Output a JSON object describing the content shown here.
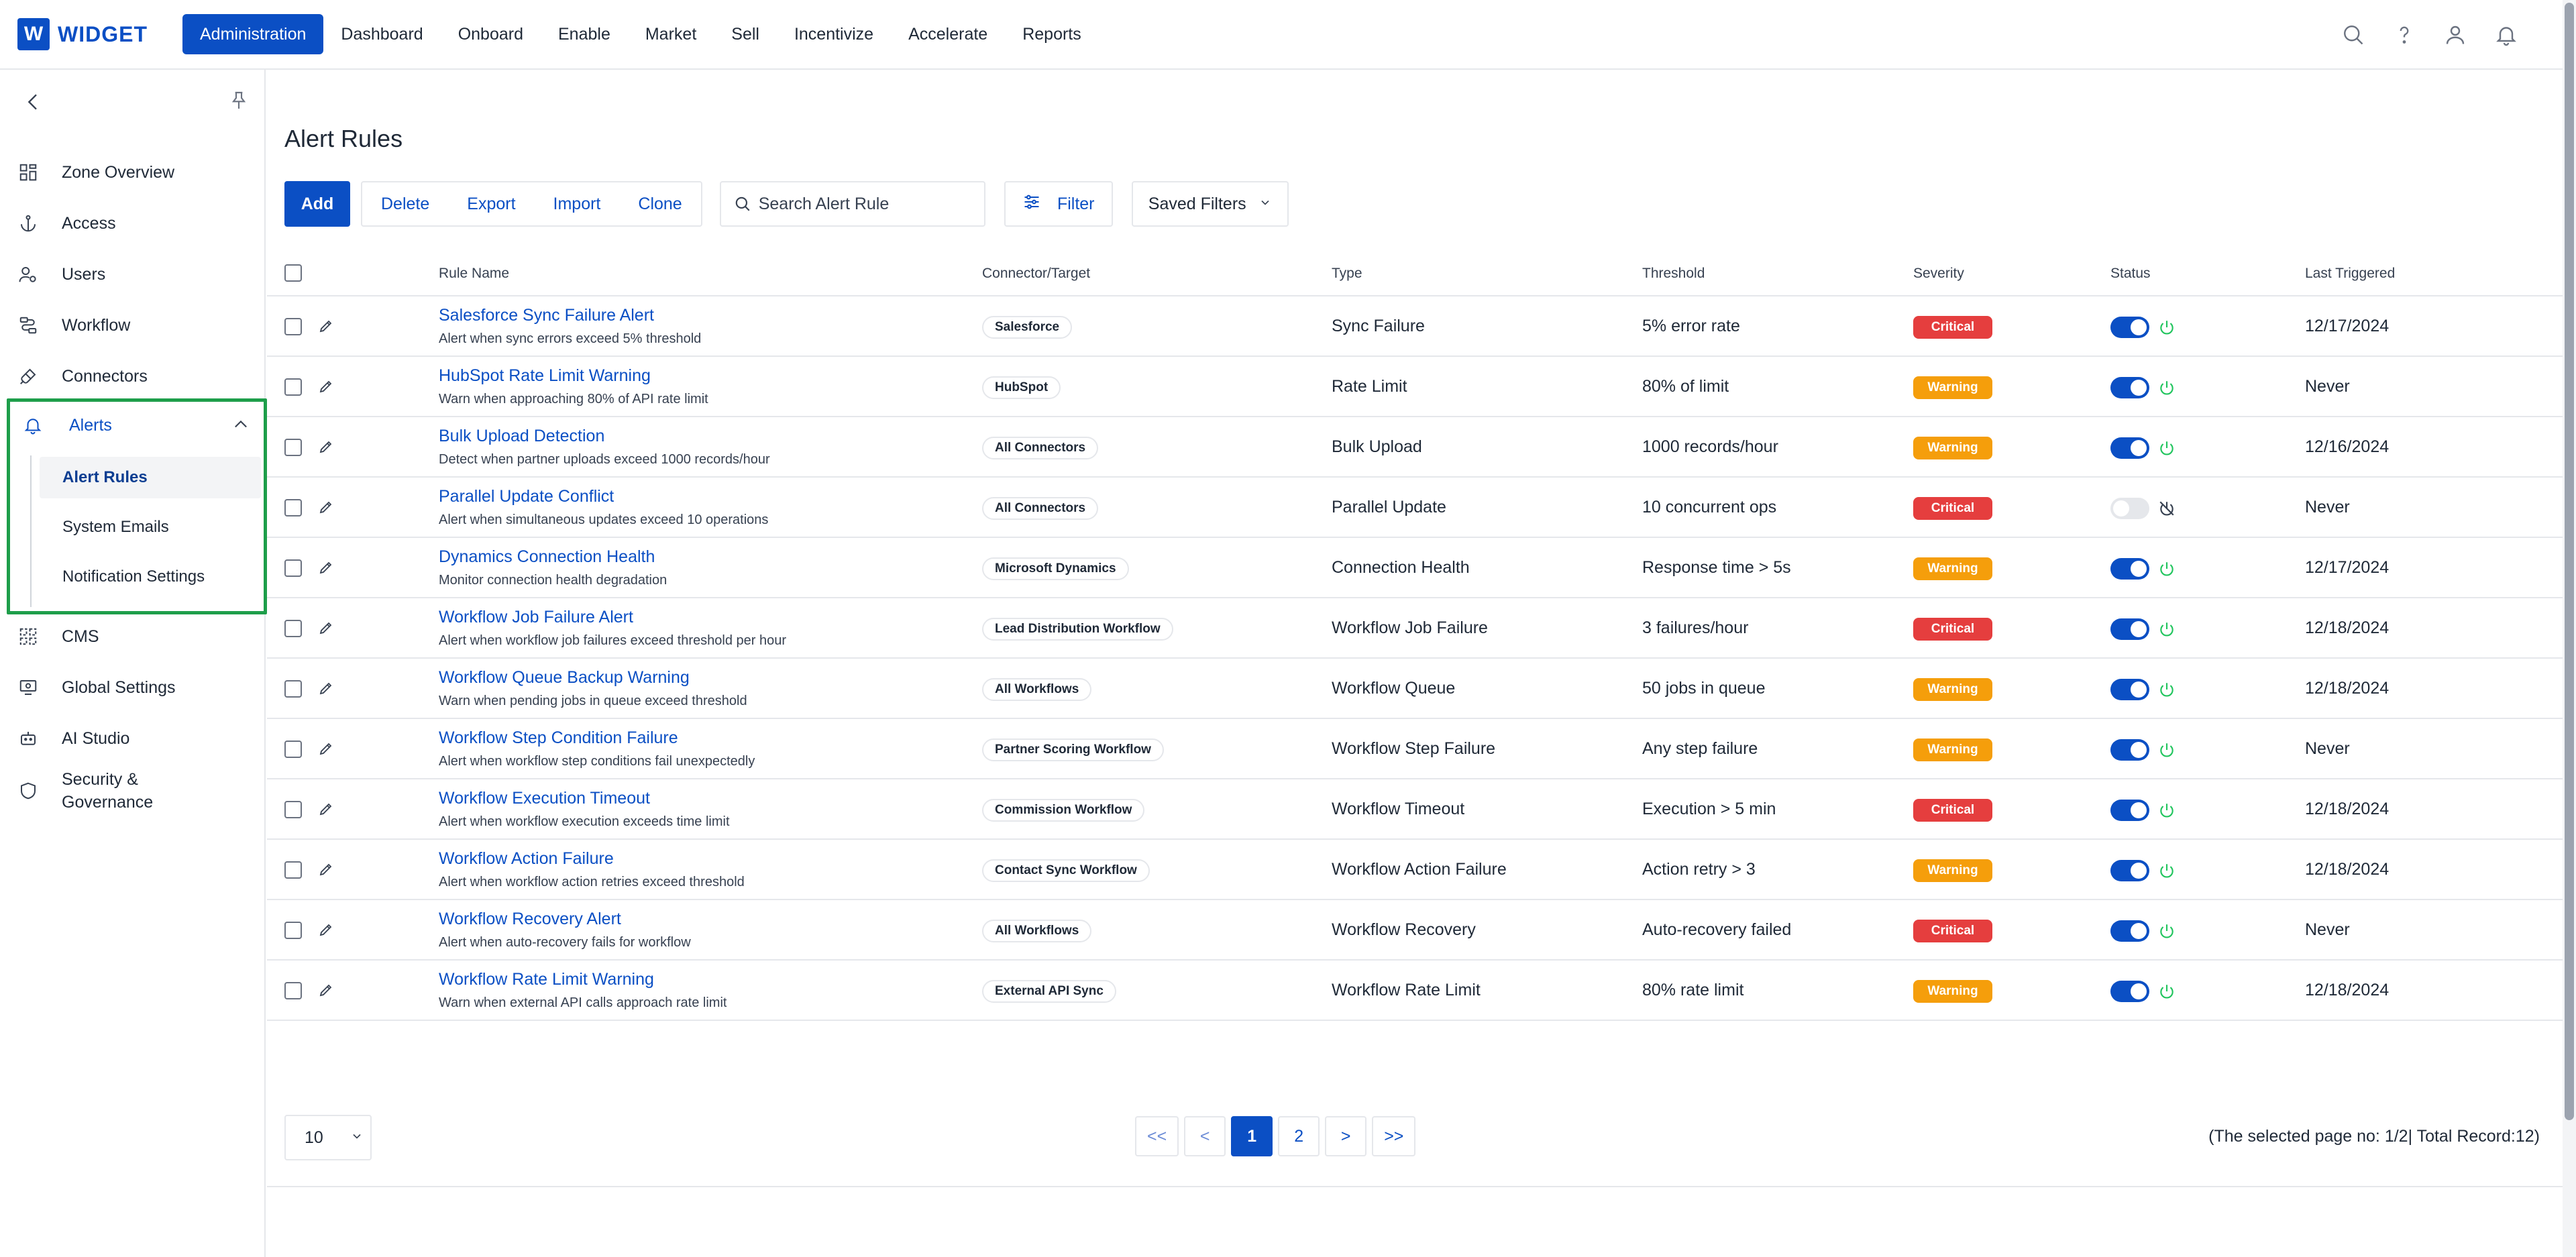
{
  "brand": {
    "logo_letter": "W",
    "name": "WIDGET",
    "color": "#0b4fc4"
  },
  "topnav": {
    "items": [
      "Administration",
      "Dashboard",
      "Onboard",
      "Enable",
      "Market",
      "Sell",
      "Incentivize",
      "Accelerate",
      "Reports"
    ],
    "active": "Administration",
    "icons": [
      "search-icon",
      "help-icon",
      "user-icon",
      "bell-icon"
    ]
  },
  "sidebar": {
    "items": [
      {
        "label": "Zone Overview",
        "icon": "grid-icon"
      },
      {
        "label": "Access",
        "icon": "anchor-icon"
      },
      {
        "label": "Users",
        "icon": "users-icon"
      },
      {
        "label": "Workflow",
        "icon": "workflow-icon"
      },
      {
        "label": "Connectors",
        "icon": "plug-icon"
      },
      {
        "label": "CMS",
        "icon": "cms-icon"
      },
      {
        "label": "Global Settings",
        "icon": "settings-icon"
      },
      {
        "label": "AI Studio",
        "icon": "robot-icon"
      },
      {
        "label": "Security & Governance",
        "icon": "shield-icon"
      }
    ],
    "alerts": {
      "label": "Alerts",
      "sub_items": [
        "Alert Rules",
        "System Emails",
        "Notification Settings"
      ],
      "active_sub": "Alert Rules",
      "highlight_color": "#1e9e4a"
    }
  },
  "page": {
    "title": "Alert Rules",
    "toolbar": {
      "add": "Add",
      "actions": [
        "Delete",
        "Export",
        "Import",
        "Clone"
      ],
      "search_placeholder": "Search Alert Rule",
      "filter": "Filter",
      "saved_filters": "Saved Filters"
    }
  },
  "table": {
    "headers": [
      "Rule Name",
      "Connector/Target",
      "Type",
      "Threshold",
      "Severity",
      "Status",
      "Last Triggered"
    ],
    "rows": [
      {
        "name": "Salesforce Sync Failure Alert",
        "desc": "Alert when sync errors exceed 5% threshold",
        "target": "Salesforce",
        "type": "Sync Failure",
        "threshold": "5% error rate",
        "severity": "Critical",
        "enabled": true,
        "last": "12/17/2024"
      },
      {
        "name": "HubSpot Rate Limit Warning",
        "desc": "Warn when approaching 80% of API rate limit",
        "target": "HubSpot",
        "type": "Rate Limit",
        "threshold": "80% of limit",
        "severity": "Warning",
        "enabled": true,
        "last": "Never"
      },
      {
        "name": "Bulk Upload Detection",
        "desc": "Detect when partner uploads exceed 1000 records/hour",
        "target": "All Connectors",
        "type": "Bulk Upload",
        "threshold": "1000 records/hour",
        "severity": "Warning",
        "enabled": true,
        "last": "12/16/2024"
      },
      {
        "name": "Parallel Update Conflict",
        "desc": "Alert when simultaneous updates exceed 10 operations",
        "target": "All Connectors",
        "type": "Parallel Update",
        "threshold": "10 concurrent ops",
        "severity": "Critical",
        "enabled": false,
        "last": "Never"
      },
      {
        "name": "Dynamics Connection Health",
        "desc": "Monitor connection health degradation",
        "target": "Microsoft Dynamics",
        "type": "Connection Health",
        "threshold": "Response time > 5s",
        "severity": "Warning",
        "enabled": true,
        "last": "12/17/2024"
      },
      {
        "name": "Workflow Job Failure Alert",
        "desc": "Alert when workflow job failures exceed threshold per hour",
        "target": "Lead Distribution Workflow",
        "type": "Workflow Job Failure",
        "threshold": "3 failures/hour",
        "severity": "Critical",
        "enabled": true,
        "last": "12/18/2024"
      },
      {
        "name": "Workflow Queue Backup Warning",
        "desc": "Warn when pending jobs in queue exceed threshold",
        "target": "All Workflows",
        "type": "Workflow Queue",
        "threshold": "50 jobs in queue",
        "severity": "Warning",
        "enabled": true,
        "last": "12/18/2024"
      },
      {
        "name": "Workflow Step Condition Failure",
        "desc": "Alert when workflow step conditions fail unexpectedly",
        "target": "Partner Scoring Workflow",
        "type": "Workflow Step Failure",
        "threshold": "Any step failure",
        "severity": "Warning",
        "enabled": true,
        "last": "Never"
      },
      {
        "name": "Workflow Execution Timeout",
        "desc": "Alert when workflow execution exceeds time limit",
        "target": "Commission Workflow",
        "type": "Workflow Timeout",
        "threshold": "Execution > 5 min",
        "severity": "Critical",
        "enabled": true,
        "last": "12/18/2024"
      },
      {
        "name": "Workflow Action Failure",
        "desc": "Alert when workflow action retries exceed threshold",
        "target": "Contact Sync Workflow",
        "type": "Workflow Action Failure",
        "threshold": "Action retry > 3",
        "severity": "Warning",
        "enabled": true,
        "last": "12/18/2024"
      },
      {
        "name": "Workflow Recovery Alert",
        "desc": "Alert when auto-recovery fails for workflow",
        "target": "All Workflows",
        "type": "Workflow Recovery",
        "threshold": "Auto-recovery failed",
        "severity": "Critical",
        "enabled": true,
        "last": "Never"
      },
      {
        "name": "Workflow Rate Limit Warning",
        "desc": "Warn when external API calls approach rate limit",
        "target": "External API Sync",
        "type": "Workflow Rate Limit",
        "threshold": "80% rate limit",
        "severity": "Warning",
        "enabled": true,
        "last": "12/18/2024"
      }
    ]
  },
  "pagination": {
    "page_size": "10",
    "buttons": [
      "<<",
      "<",
      "1",
      "2",
      ">",
      ">>"
    ],
    "current": "1",
    "info": "(The selected page no: 1/2| Total Record:12)"
  },
  "colors": {
    "critical": "#e53e3e",
    "warning": "#f59e0b",
    "active_green": "#22c55e",
    "primary": "#0b4fc4"
  }
}
